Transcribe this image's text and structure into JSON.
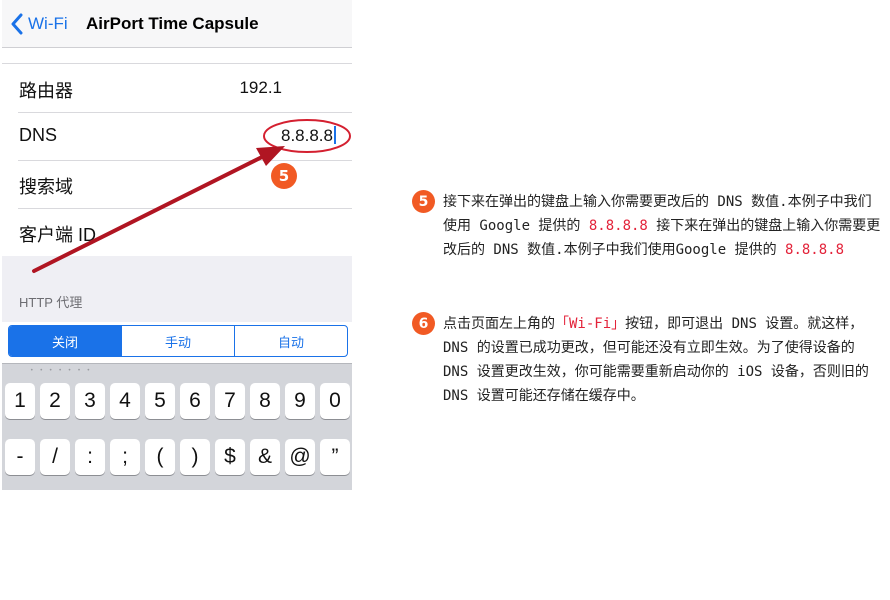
{
  "phone": {
    "navbar": {
      "back_label": "Wi-Fi",
      "title": "AirPort Time Capsule"
    },
    "rows": [
      {
        "label": "路由器",
        "value": "192.1"
      },
      {
        "label": "DNS",
        "value": "8.8.8.8"
      },
      {
        "label": "搜索域",
        "value": ""
      },
      {
        "label": "客户端 ID",
        "value": ""
      }
    ],
    "http_proxy_header": "HTTP 代理",
    "segments": [
      "关闭",
      "手动",
      "自动"
    ],
    "selected_segment": "关闭",
    "keyboard": {
      "row1": [
        "1",
        "2",
        "3",
        "4",
        "5",
        "6",
        "7",
        "8",
        "9",
        "0"
      ],
      "row2": [
        "-",
        "/",
        ":",
        ";",
        "(",
        ")",
        "$",
        "&",
        "@",
        "”"
      ]
    },
    "annotation_badge": "5"
  },
  "colors": {
    "accent": "#1a72e8",
    "badge": "#f15a24",
    "highlight": "#e3233a",
    "arrow": "#d42030"
  },
  "steps": [
    {
      "number": "5",
      "text_before": "接下来在弹出的键盘上输入你需要更改后的 DNS 数值.本例子中我们使用 Google 提供的 ",
      "highlight": "8.8.8.8",
      "text_middle": " 接下来在弹出的键盘上输入你需要更改后的 DNS 数值.本例子中我们使用Google 提供的 ",
      "highlight2": "8.8.8.8"
    },
    {
      "number": "6",
      "text_before": "点击页面左上角的",
      "highlight": "「Wi-Fi」",
      "text_after": "按钮，即可退出 DNS 设置。就这样，DNS 的设置已成功更改，但可能还没有立即生效。为了使得设备的 DNS 设置更改生效，你可能需要重新启动你的 iOS 设备，否则旧的 DNS 设置可能还存储在缓存中。"
    }
  ]
}
